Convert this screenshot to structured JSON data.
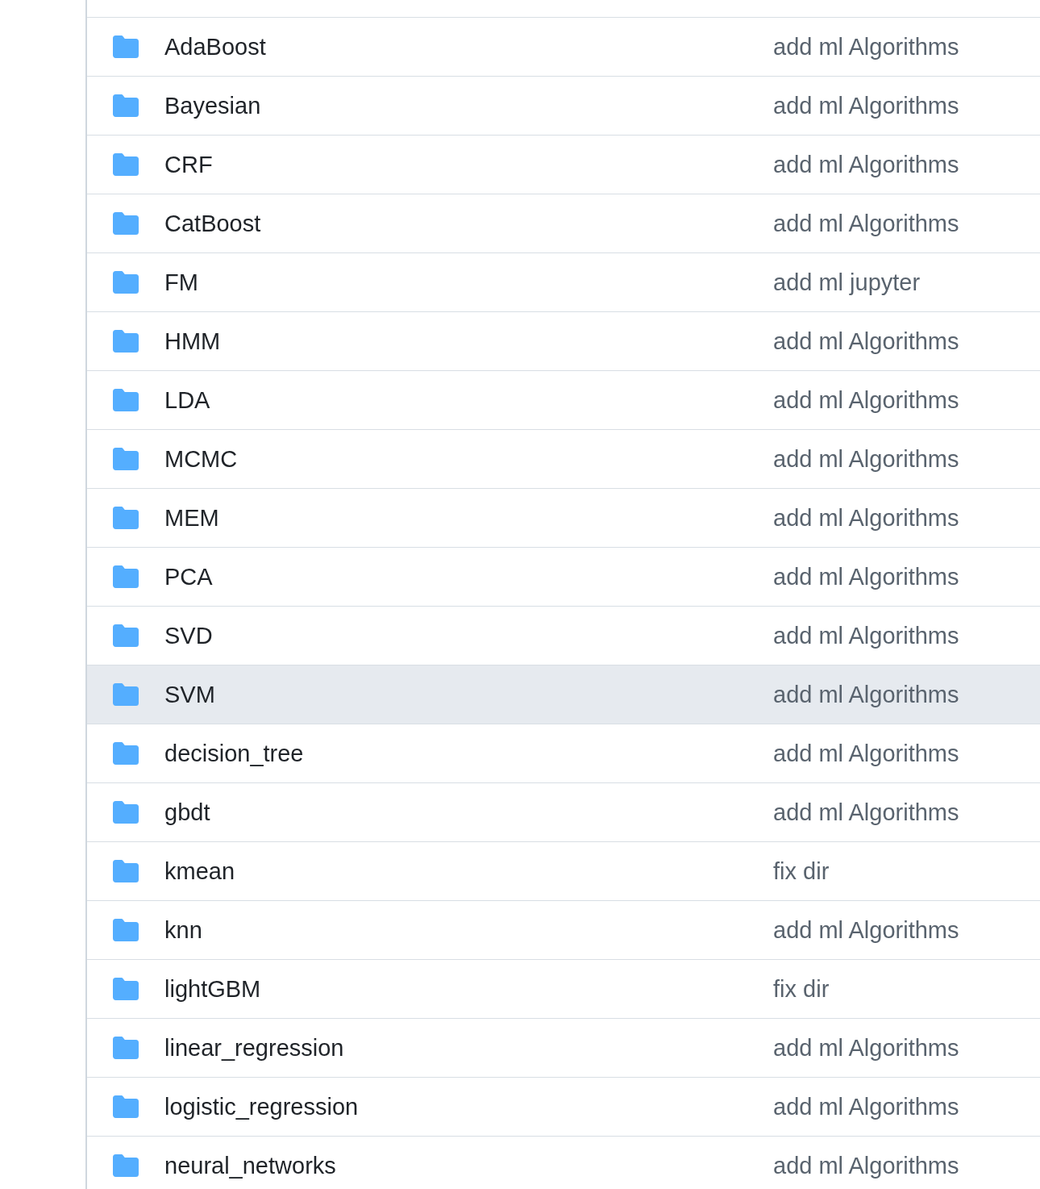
{
  "file_list": {
    "rows": [
      {
        "name": "AdaBoost",
        "commit_message": "add ml Algorithms",
        "highlighted": false
      },
      {
        "name": "Bayesian",
        "commit_message": "add ml Algorithms",
        "highlighted": false
      },
      {
        "name": "CRF",
        "commit_message": "add ml Algorithms",
        "highlighted": false
      },
      {
        "name": "CatBoost",
        "commit_message": "add ml Algorithms",
        "highlighted": false
      },
      {
        "name": "FM",
        "commit_message": "add ml jupyter",
        "highlighted": false
      },
      {
        "name": "HMM",
        "commit_message": "add ml Algorithms",
        "highlighted": false
      },
      {
        "name": "LDA",
        "commit_message": "add ml Algorithms",
        "highlighted": false
      },
      {
        "name": "MCMC",
        "commit_message": "add ml Algorithms",
        "highlighted": false
      },
      {
        "name": "MEM",
        "commit_message": "add ml Algorithms",
        "highlighted": false
      },
      {
        "name": "PCA",
        "commit_message": "add ml Algorithms",
        "highlighted": false
      },
      {
        "name": "SVD",
        "commit_message": "add ml Algorithms",
        "highlighted": false
      },
      {
        "name": "SVM",
        "commit_message": "add ml Algorithms",
        "highlighted": true
      },
      {
        "name": "decision_tree",
        "commit_message": "add ml Algorithms",
        "highlighted": false
      },
      {
        "name": "gbdt",
        "commit_message": "add ml Algorithms",
        "highlighted": false
      },
      {
        "name": "kmean",
        "commit_message": "fix dir",
        "highlighted": false
      },
      {
        "name": "knn",
        "commit_message": "add ml Algorithms",
        "highlighted": false
      },
      {
        "name": "lightGBM",
        "commit_message": "fix dir",
        "highlighted": false
      },
      {
        "name": "linear_regression",
        "commit_message": "add ml Algorithms",
        "highlighted": false
      },
      {
        "name": "logistic_regression",
        "commit_message": "add ml Algorithms",
        "highlighted": false
      },
      {
        "name": "neural_networks",
        "commit_message": "add ml Algorithms",
        "highlighted": false
      }
    ]
  }
}
